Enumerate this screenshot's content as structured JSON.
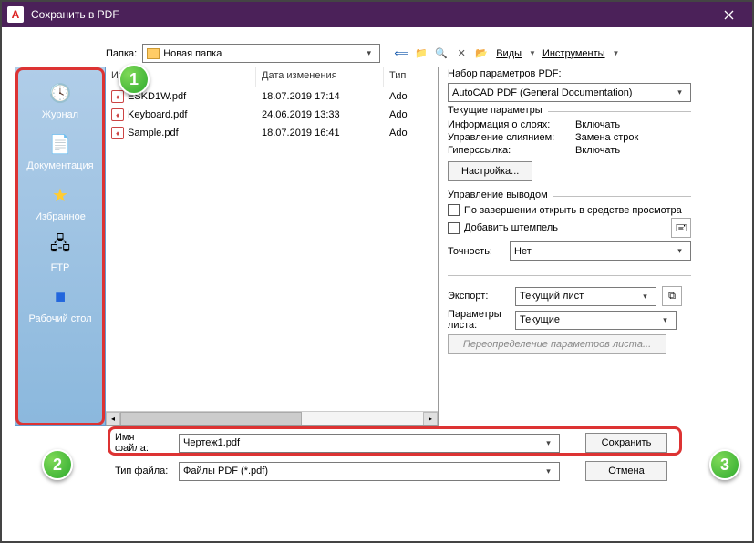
{
  "titlebar": {
    "title": "Сохранить в PDF"
  },
  "top": {
    "folder_label": "Папка:",
    "folder_value": "Новая папка",
    "view_label": "Виды",
    "tools_label": "Инструменты"
  },
  "sidebar": {
    "items": [
      {
        "label": "Журнал",
        "icon": "🕓"
      },
      {
        "label": "Документация",
        "icon": "📄"
      },
      {
        "label": "Избранное",
        "icon": "⭐"
      },
      {
        "label": "FTP",
        "icon": "🖥"
      },
      {
        "label": "Рабочий стол",
        "icon": "🖵"
      }
    ]
  },
  "columns": {
    "name": "Имя",
    "date": "Дата изменения",
    "type": "Тип"
  },
  "files": [
    {
      "name": "ESKD1W.pdf",
      "date": "18.07.2019 17:14",
      "type": "Ado"
    },
    {
      "name": "Keyboard.pdf",
      "date": "24.06.2019 13:33",
      "type": "Ado"
    },
    {
      "name": "Sample.pdf",
      "date": "18.07.2019 16:41",
      "type": "Ado"
    }
  ],
  "right": {
    "preset_label": "Набор параметров PDF:",
    "preset_value": "AutoCAD PDF (General Documentation)",
    "current_params_title": "Текущие параметры",
    "layers_label": "Информация о слоях:",
    "layers_value": "Включать",
    "merge_label": "Управление слиянием:",
    "merge_value": "Замена строк",
    "hyperlink_label": "Гиперссылка:",
    "hyperlink_value": "Включать",
    "settings_btn": "Настройка...",
    "output_title": "Управление выводом",
    "open_after_label": "По завершении открыть в средстве просмотра",
    "stamp_label": "Добавить штемпель",
    "precision_label": "Точность:",
    "precision_value": "Нет",
    "export_label": "Экспорт:",
    "export_value": "Текущий лист",
    "sheet_params_label": "Параметры листа:",
    "sheet_params_value": "Текущие",
    "override_btn": "Переопределение параметров листа..."
  },
  "bottom": {
    "filename_label": "Имя файла:",
    "filename_value": "Чертеж1.pdf",
    "filetype_label": "Тип файла:",
    "filetype_value": "Файлы PDF (*.pdf)",
    "save_btn": "Сохранить",
    "cancel_btn": "Отмена"
  },
  "annotations": {
    "a1": "1",
    "a2": "2",
    "a3": "3"
  }
}
